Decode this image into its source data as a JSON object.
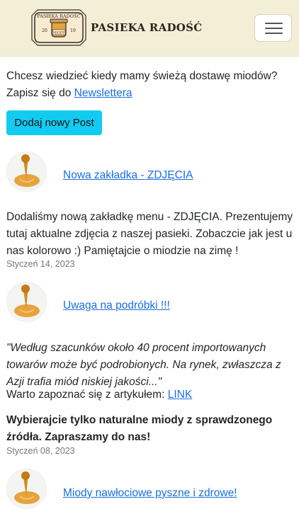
{
  "navbar": {
    "logo_top_text": "PASIEKA RADOŚĆ",
    "logo_left_year": "20",
    "logo_center": "MIODY",
    "logo_right_year": "19",
    "brand_text": "PASIEKA RADOŚĆ",
    "menu_icon": "hamburger-icon"
  },
  "newsletter": {
    "text": "Chcesz wiedzieć kiedy mamy świeżą dostawę miodów? Zapisz się do",
    "link_text": "Newslettera"
  },
  "add_post_label": "Dodaj nowy Post",
  "posts": [
    {
      "title": "Nowa zakładka - ZDJĘCIA",
      "body": "Dodaliśmy nową zakładkę menu - ZDJĘCIA. Prezentujemy tutaj aktualne zdjęcia z naszej pasieki. Zobaczcie jak jest u nas kolorowo :) Pamiętajcie o miodzie na zimę !",
      "date": "Styczeń 14, 2023"
    },
    {
      "title": "Uwaga na podróbki !!!",
      "quote": "\"Według szacunków około 40 procent importowanych towarów może być podrobionych. Na rynek, zwłaszcza z Azji trafia miód niskiej jakości...\"",
      "link_prefix": "Warto zapoznać się z artykułem:",
      "link_text": "LINK",
      "bold": "Wybierajcie tylko naturalne miody z sprawdzonego źródła. Zapraszamy do nas!",
      "date": "Styczeń 08, 2023"
    },
    {
      "title": "Miody nawłociowe pyszne i zdrowe!"
    }
  ],
  "colors": {
    "navbar_bg": "#f3efd6",
    "button_bg": "#13cbf0",
    "link": "#1a6fe0",
    "honey": "#e6a23c"
  }
}
